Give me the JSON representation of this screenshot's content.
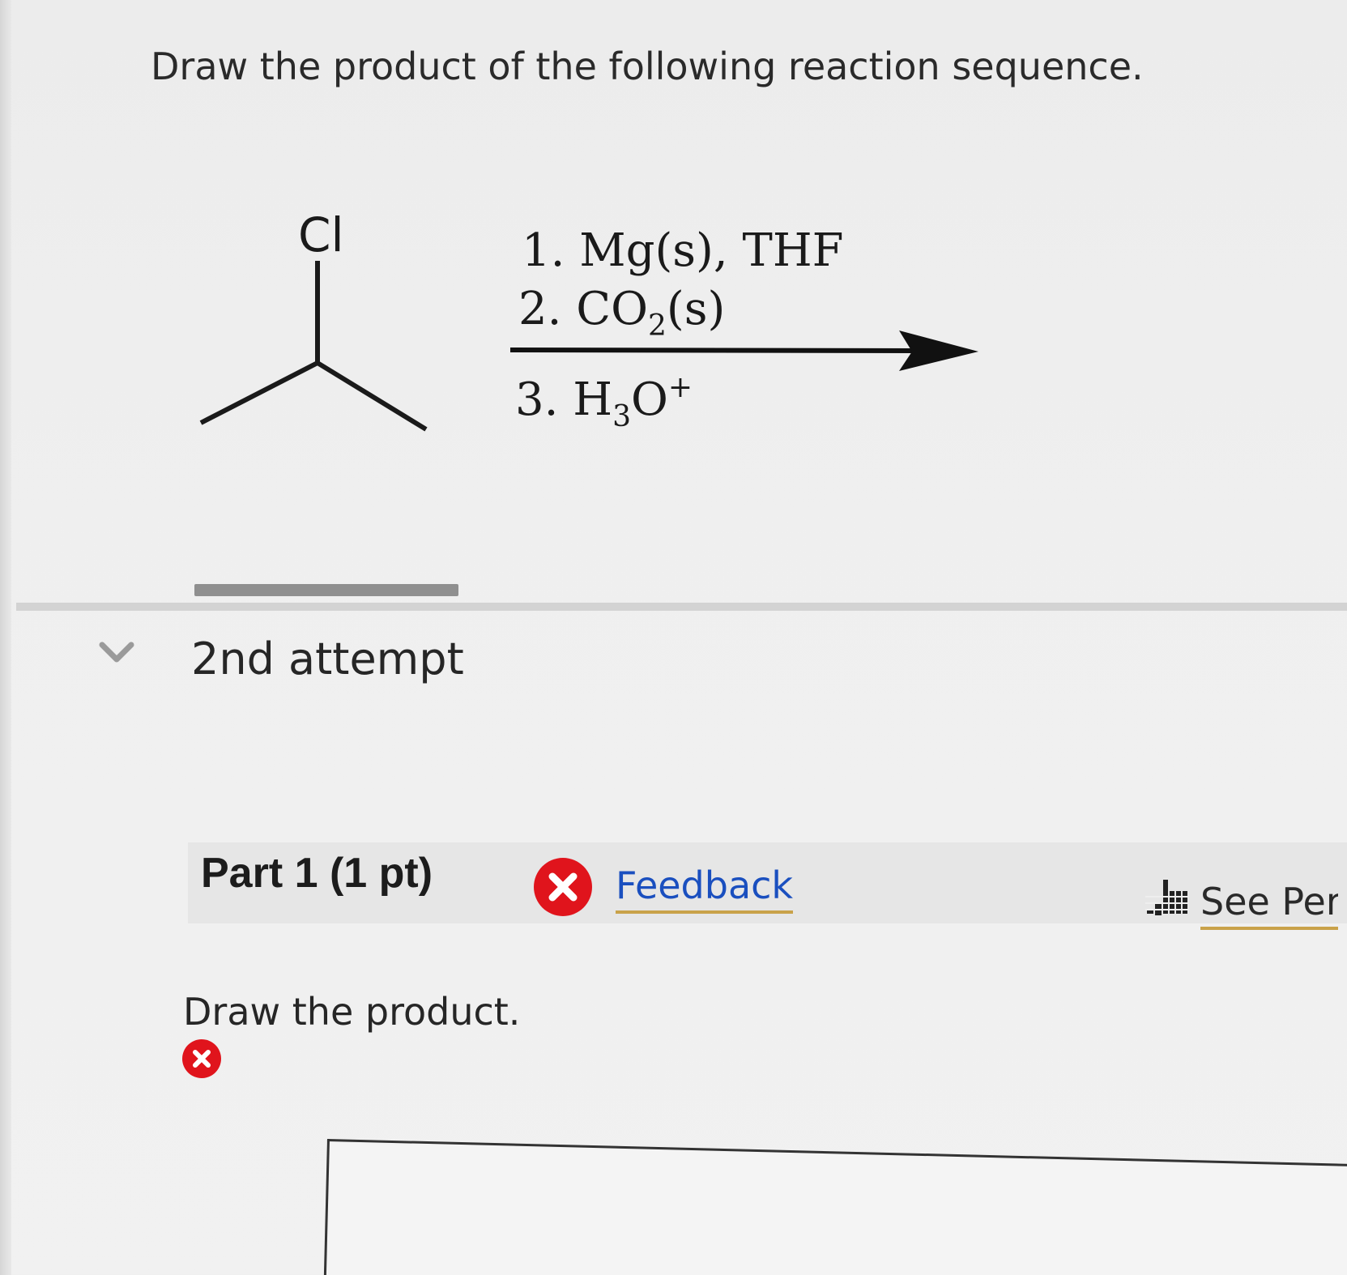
{
  "question": {
    "prompt": "Draw the product of the following reaction sequence."
  },
  "reaction": {
    "substituent_label": "Cl",
    "step1_prefix": "1.",
    "step1_reagent": "Mg(s), THF",
    "step2_prefix": "2.",
    "step2_reagent": "CO",
    "step2_subscript": "2",
    "step2_suffix": "(s)",
    "step3_prefix": "3.",
    "step3_reagent_h": "H",
    "step3_subscript": "3",
    "step3_reagent_o": "O",
    "step3_superscript": "+"
  },
  "attempt": {
    "title": "2nd attempt"
  },
  "part": {
    "title": "Part 1 (1 pt)",
    "feedback_label": "Feedback",
    "periodic_label": "See Peri"
  },
  "task": {
    "instruction": "Draw the product."
  },
  "colors": {
    "error_red": "#e0141c",
    "link_blue": "#1a4fbf",
    "underline_gold": "#c9a24a"
  }
}
